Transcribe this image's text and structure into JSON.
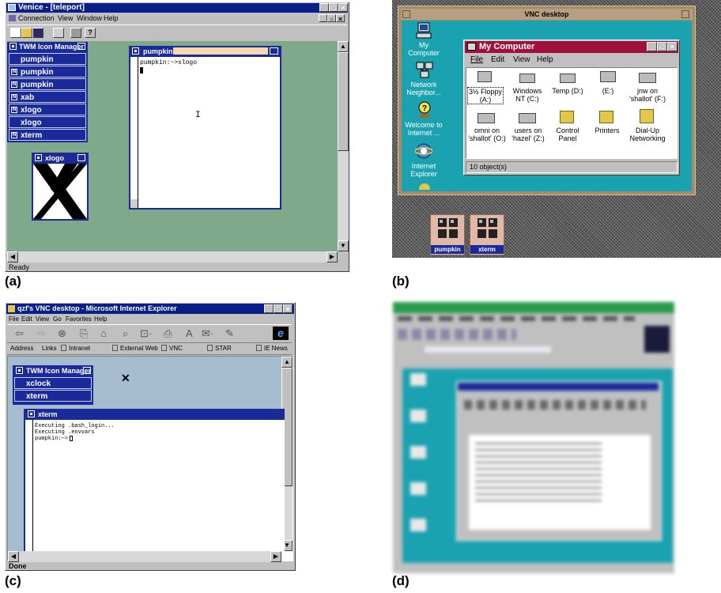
{
  "captions": {
    "a": "(a)",
    "b": "(b)",
    "c": "(c)",
    "d": "(d)"
  },
  "panel_a": {
    "title": "Venice - [teleport]",
    "menu": [
      "Connection",
      "View",
      "Window",
      "Help"
    ],
    "twm_title": "TWM Icon Manager",
    "twm_items": [
      "pumpkin",
      "pumpkin",
      "pumpkin",
      "xab",
      "xlogo",
      "xlogo",
      "xterm"
    ],
    "xlogo_title": "xlogo",
    "pumpkin_title": "pumpkin",
    "terminal_line": "pumpkin:~>xlogo",
    "status": "Ready"
  },
  "panel_b": {
    "title": "VNC desktop",
    "desktop_icons": [
      "My Computer",
      "Network Neighbor...",
      "Welcome to Internet ...",
      "Internet Explorer"
    ],
    "mycomputer_title": "My Computer",
    "menu": [
      "File",
      "Edit",
      "View",
      "Help"
    ],
    "items": [
      "3½ Floppy (A:)",
      "Windows NT (C:)",
      "Temp (D:)",
      "(E:)",
      "jnw on 'shallot' (F:)",
      "omni on 'shallot' (O:)",
      "users on 'hazel' (Z:)",
      "Control Panel",
      "Printers",
      "Dial-Up Networking"
    ],
    "status": "10 object(s)",
    "icons": [
      "pumpkin",
      "xterm"
    ]
  },
  "panel_c": {
    "title": "qzf's VNC desktop - Microsoft Internet Explorer",
    "menu": [
      "File",
      "Edit",
      "View",
      "Go",
      "Favorites",
      "Help"
    ],
    "address_label": "Address",
    "links_label": "Links",
    "links": [
      "Intranet",
      "External Web",
      "VNC",
      "STAR",
      "IE News"
    ],
    "twm_title": "TWM Icon Manager",
    "twm_items": [
      "xclock",
      "xterm"
    ],
    "xterm_title": "xterm",
    "terminal_lines": [
      "Executing .bash_login...",
      "Executing .envvars",
      "pumpkin:~>"
    ],
    "status": "Done"
  },
  "colors": {
    "twm_blue": "#1a2a9a",
    "x_desktop_green": "#7fa98a",
    "win_desktop_teal": "#1aa2b0",
    "vnc_slate": "#a6bdd0"
  }
}
